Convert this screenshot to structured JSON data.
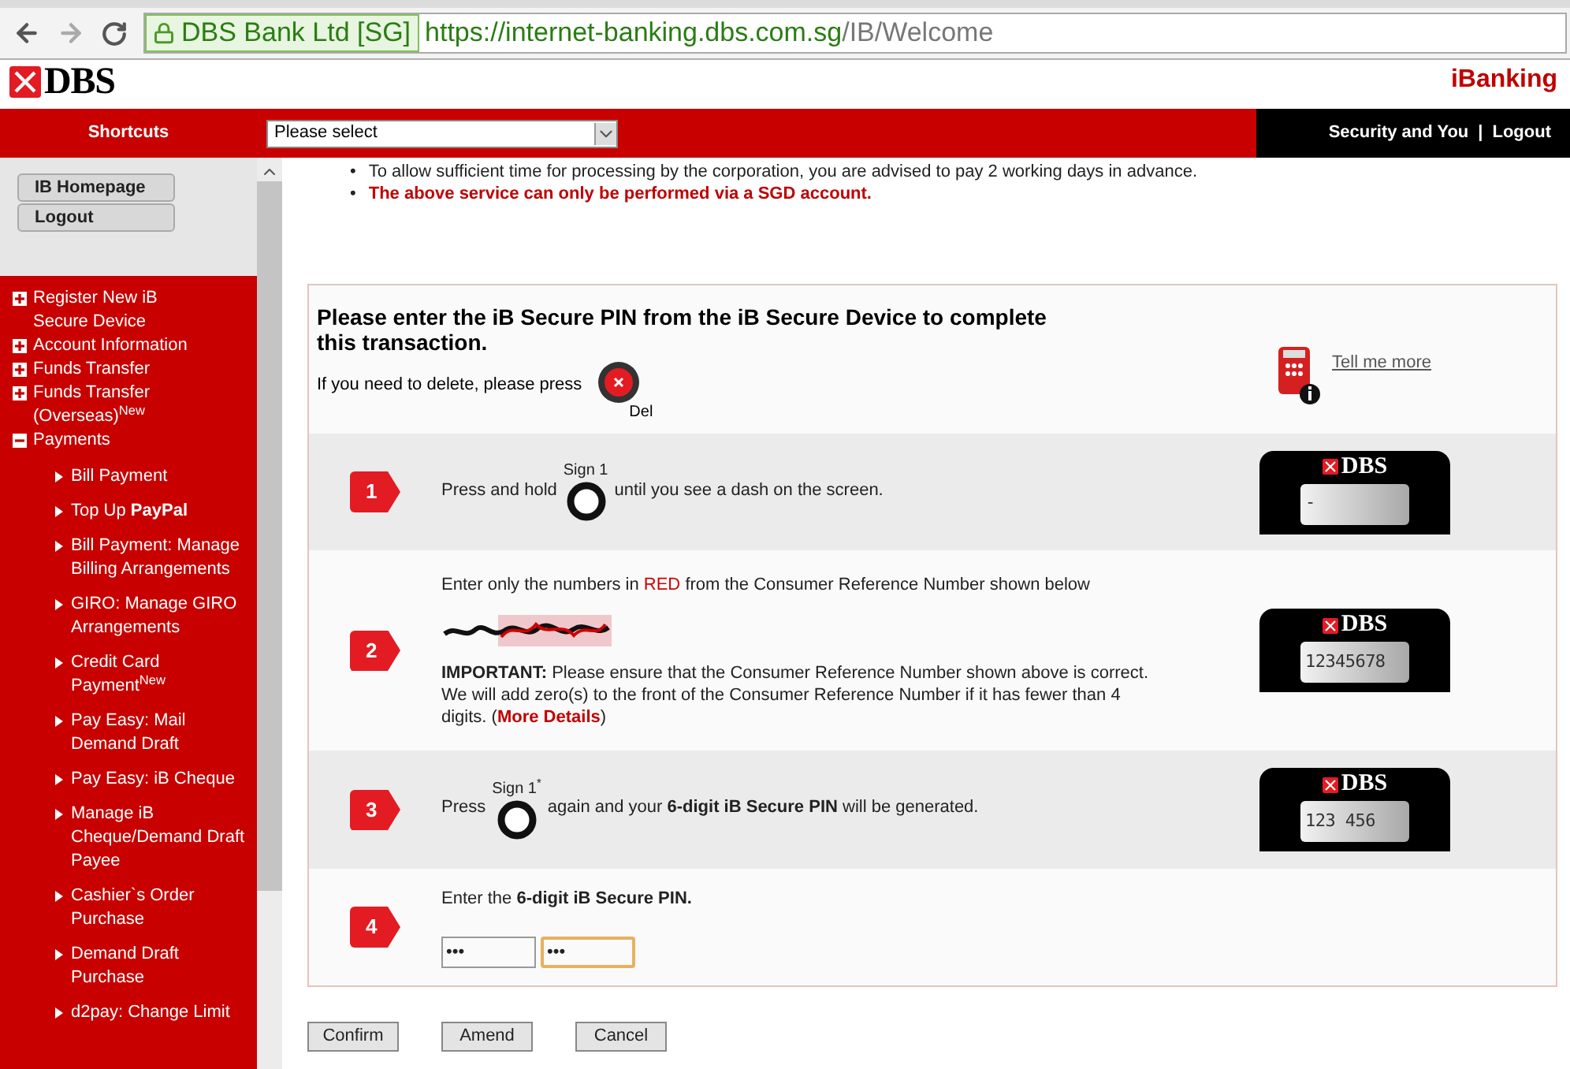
{
  "browser": {
    "certificate": "DBS Bank Ltd [SG]",
    "url_host": "https://internet-banking.dbs.com.sg",
    "url_path": "/IB/Welcome"
  },
  "header": {
    "logo": "DBS",
    "product": "iBanking"
  },
  "nav": {
    "title": "Shortcuts",
    "shortcut_select": {
      "value": "Please select"
    },
    "links": [
      "Security and You",
      "Logout"
    ],
    "separator": "|"
  },
  "sidebar": {
    "buttons": [
      "IB Homepage",
      "Logout"
    ],
    "items": [
      {
        "label": "Register New iB Secure Device",
        "expanded": false
      },
      {
        "label": "Account Information",
        "expanded": false
      },
      {
        "label": "Funds Transfer",
        "expanded": false
      },
      {
        "label": "Funds Transfer (Overseas)$^{New}$",
        "expanded": false
      },
      {
        "label": "Payments",
        "expanded": true,
        "children": [
          {
            "label": "Bill Payment"
          },
          {
            "label": "Top Up **PayPal**"
          },
          {
            "label": "Bill Payment: Manage Billing Arrangements"
          },
          {
            "label": "GIRO: Manage GIRO Arrangements"
          },
          {
            "label": "Credit Card Payment$^{New}$"
          },
          {
            "label": "Pay Easy: Mail Demand Draft"
          },
          {
            "label": "Pay Easy: iB Cheque"
          },
          {
            "label": "Manage iB Cheque/Demand Draft Payee"
          },
          {
            "label": "Cashier`s Order Purchase"
          },
          {
            "label": "Demand Draft Purchase"
          },
          {
            "label": "d2pay: Change Limit"
          }
        ]
      }
    ]
  },
  "notes": [
    {
      "bullet": "•",
      "text": "To allow sufficient time for processing by the corporation, you are advised to pay 2 working days in advance.",
      "kind": "plain"
    },
    {
      "bullet": "•",
      "text": "The above service can only be performed via a SGD account.",
      "kind": "warning"
    }
  ],
  "pin_panel": {
    "title": "Please enter the iB Secure PIN from the iB Secure Device to complete this transaction.",
    "delete_hint": "If you need to delete, please press",
    "delete_key": "Del",
    "help_link": "Tell me more",
    "steps": [
      {
        "number": "1",
        "kind": "key_press",
        "before": "Press and hold",
        "key_label": "Sign 1",
        "after": "until you see a dash on the screen.",
        "token_logo": "DBS",
        "token_display": "-"
      },
      {
        "number": "2",
        "kind": "reference",
        "instruction": [
          {
            "text": "Enter only the numbers in ",
            "kind": "plain"
          },
          {
            "text": "RED",
            "kind": "red"
          },
          {
            "text": " from the Consumer Reference Number shown below",
            "kind": "plain"
          }
        ],
        "note": "**IMPORTANT:** Please ensure that the Consumer Reference Number shown above is correct. We will add zero(s) to the front of the Consumer Reference Number if it has fewer than 4 digits. (",
        "link": "More Details",
        "note_end": ")",
        "token_logo": "DBS",
        "token_display": "12345678"
      },
      {
        "number": "3",
        "kind": "key_press",
        "before": "Press",
        "key_label": "Sign 1$^{*}$",
        "after": "again and your **6-digit iB Secure PIN** will be generated.",
        "token_logo": "DBS",
        "token_display": "123 456"
      },
      {
        "number": "4",
        "kind": "pin_entry",
        "instruction": "Enter the **6-digit iB Secure PIN.**",
        "fields": [
          {
            "value": "•••",
            "focused": false
          },
          {
            "value": "•••",
            "focused": true
          }
        ]
      }
    ]
  },
  "actions": [
    "Confirm",
    "Amend",
    "Cancel"
  ]
}
